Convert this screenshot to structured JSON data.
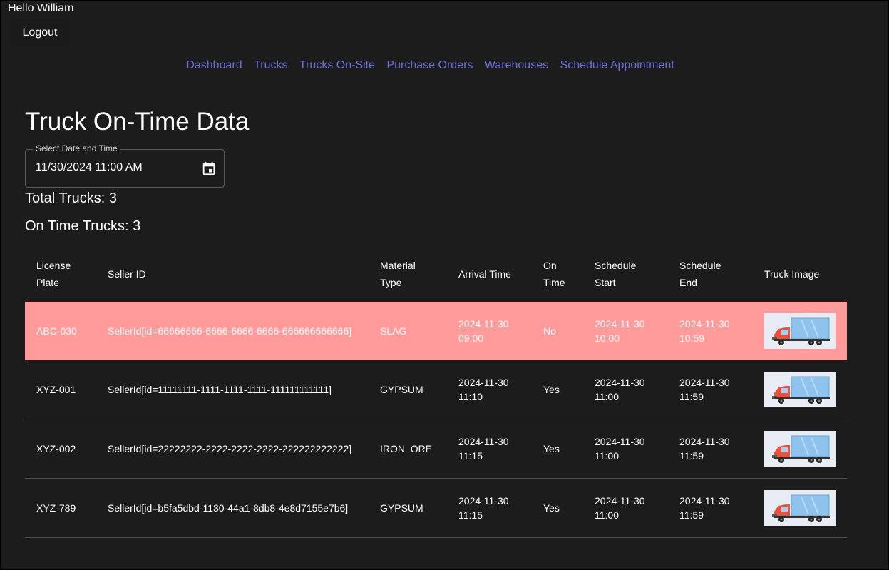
{
  "header": {
    "greeting": "Hello William",
    "logout_label": "Logout"
  },
  "nav": {
    "links": [
      "Dashboard",
      "Trucks",
      "Trucks On-Site",
      "Purchase Orders",
      "Warehouses",
      "Schedule Appointment"
    ]
  },
  "page": {
    "title": "Truck On-Time Data",
    "date_field_label": "Select Date and Time",
    "date_field_value": "11/30/2024 11:00 AM",
    "total_trucks": "Total Trucks: 3",
    "on_time_trucks": "On Time Trucks: 3"
  },
  "table": {
    "headers": {
      "license_plate": [
        "License",
        "Plate"
      ],
      "seller_id": "Seller ID",
      "material_type": [
        "Material",
        "Type"
      ],
      "arrival_time": "Arrival Time",
      "on_time": [
        "On",
        "Time"
      ],
      "schedule_start": [
        "Schedule",
        "Start"
      ],
      "schedule_end": [
        "Schedule",
        "End"
      ],
      "truck_image": "Truck Image"
    },
    "rows": [
      {
        "license_plate": "ABC-030",
        "seller_id": "SellerId[id=66666666-6666-6666-6666-666666666666]",
        "material_type": "SLAG",
        "arrival_date": "2024-11-30",
        "arrival_time": "09:00",
        "on_time": "No",
        "start_date": "2024-11-30",
        "start_time": "10:00",
        "end_date": "2024-11-30",
        "end_time": "10:59"
      },
      {
        "license_plate": "XYZ-001",
        "seller_id": "SellerId[id=11111111-1111-1111-1111-111111111111]",
        "material_type": "GYPSUM",
        "arrival_date": "2024-11-30",
        "arrival_time": "11:10",
        "on_time": "Yes",
        "start_date": "2024-11-30",
        "start_time": "11:00",
        "end_date": "2024-11-30",
        "end_time": "11:59"
      },
      {
        "license_plate": "XYZ-002",
        "seller_id": "SellerId[id=22222222-2222-2222-2222-222222222222]",
        "material_type": "IRON_ORE",
        "arrival_date": "2024-11-30",
        "arrival_time": "11:15",
        "on_time": "Yes",
        "start_date": "2024-11-30",
        "start_time": "11:00",
        "end_date": "2024-11-30",
        "end_time": "11:59"
      },
      {
        "license_plate": "XYZ-789",
        "seller_id": "SellerId[id=b5fa5dbd-1130-44a1-8db8-4e8d7155e7b6]",
        "material_type": "GYPSUM",
        "arrival_date": "2024-11-30",
        "arrival_time": "11:15",
        "on_time": "Yes",
        "start_date": "2024-11-30",
        "start_time": "11:00",
        "end_date": "2024-11-30",
        "end_time": "11:59"
      }
    ]
  },
  "colors": {
    "background": "#1c1c1c",
    "nav_link": "#6a6fe0",
    "late_row": "#ff9b9b"
  },
  "icons": {
    "date_picker": "calendar-icon",
    "truck_image": "truck-image"
  }
}
